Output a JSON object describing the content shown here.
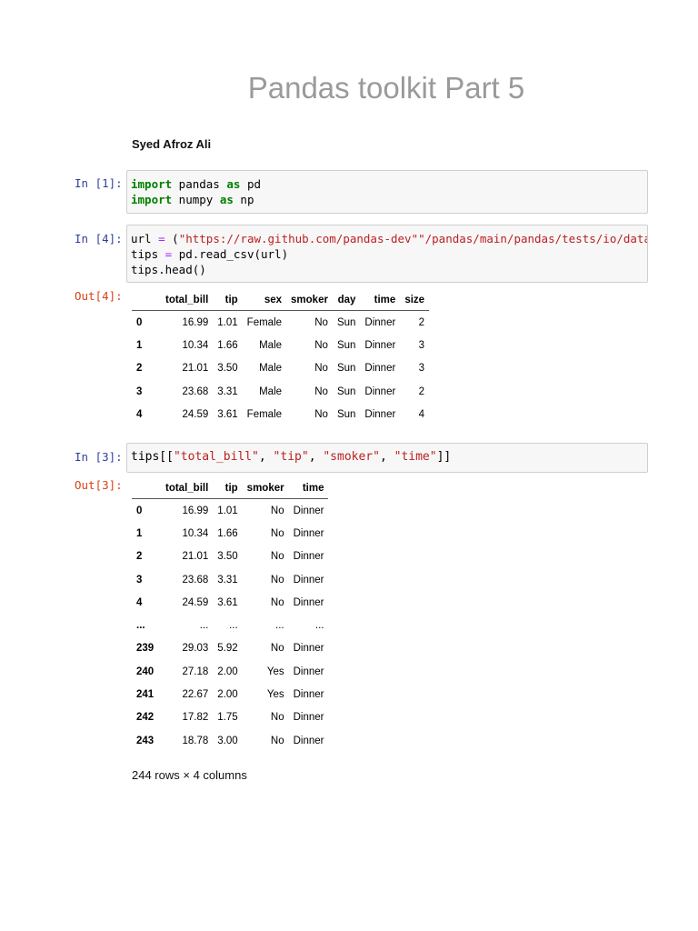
{
  "title": "Pandas toolkit Part 5",
  "author": "Syed Afroz Ali",
  "cells": [
    {
      "prompt": "In [1]:",
      "lines": [
        [
          "import",
          " pandas ",
          "as",
          " pd"
        ],
        [
          "import",
          " numpy ",
          "as",
          " np"
        ]
      ]
    },
    {
      "prompt": "In [4]:",
      "line1_a": "url ",
      "line1_eq": "=",
      "line1_b": " (",
      "line1_str": "\"https://raw.github.com/pandas-dev\"\"/pandas/main/pandas/tests/io/data/csv/tips.csv\"",
      "line2_a": "tips ",
      "line2_eq": "=",
      "line2_b": " pd.read_csv(url)",
      "line3": "tips.head()",
      "out_prompt": "Out[4]:"
    },
    {
      "prompt": "In [3]:",
      "code_a": "tips[[",
      "s1": "\"total_bill\"",
      "s2": "\"tip\"",
      "s3": "\"smoker\"",
      "s4": "\"time\"",
      "sep": ", ",
      "code_b": "]]",
      "out_prompt": "Out[3]:"
    }
  ],
  "table1": {
    "columns": [
      "",
      "total_bill",
      "tip",
      "sex",
      "smoker",
      "day",
      "time",
      "size"
    ],
    "rows": [
      [
        "0",
        "16.99",
        "1.01",
        "Female",
        "No",
        "Sun",
        "Dinner",
        "2"
      ],
      [
        "1",
        "10.34",
        "1.66",
        "Male",
        "No",
        "Sun",
        "Dinner",
        "3"
      ],
      [
        "2",
        "21.01",
        "3.50",
        "Male",
        "No",
        "Sun",
        "Dinner",
        "3"
      ],
      [
        "3",
        "23.68",
        "3.31",
        "Male",
        "No",
        "Sun",
        "Dinner",
        "2"
      ],
      [
        "4",
        "24.59",
        "3.61",
        "Female",
        "No",
        "Sun",
        "Dinner",
        "4"
      ]
    ]
  },
  "table2": {
    "columns": [
      "",
      "total_bill",
      "tip",
      "smoker",
      "time"
    ],
    "rows": [
      [
        "0",
        "16.99",
        "1.01",
        "No",
        "Dinner"
      ],
      [
        "1",
        "10.34",
        "1.66",
        "No",
        "Dinner"
      ],
      [
        "2",
        "21.01",
        "3.50",
        "No",
        "Dinner"
      ],
      [
        "3",
        "23.68",
        "3.31",
        "No",
        "Dinner"
      ],
      [
        "4",
        "24.59",
        "3.61",
        "No",
        "Dinner"
      ],
      [
        "...",
        "...",
        "...",
        "...",
        "..."
      ],
      [
        "239",
        "29.03",
        "5.92",
        "No",
        "Dinner"
      ],
      [
        "240",
        "27.18",
        "2.00",
        "Yes",
        "Dinner"
      ],
      [
        "241",
        "22.67",
        "2.00",
        "Yes",
        "Dinner"
      ],
      [
        "242",
        "17.82",
        "1.75",
        "No",
        "Dinner"
      ],
      [
        "243",
        "18.78",
        "3.00",
        "No",
        "Dinner"
      ]
    ],
    "footer": "244 rows × 4 columns"
  }
}
